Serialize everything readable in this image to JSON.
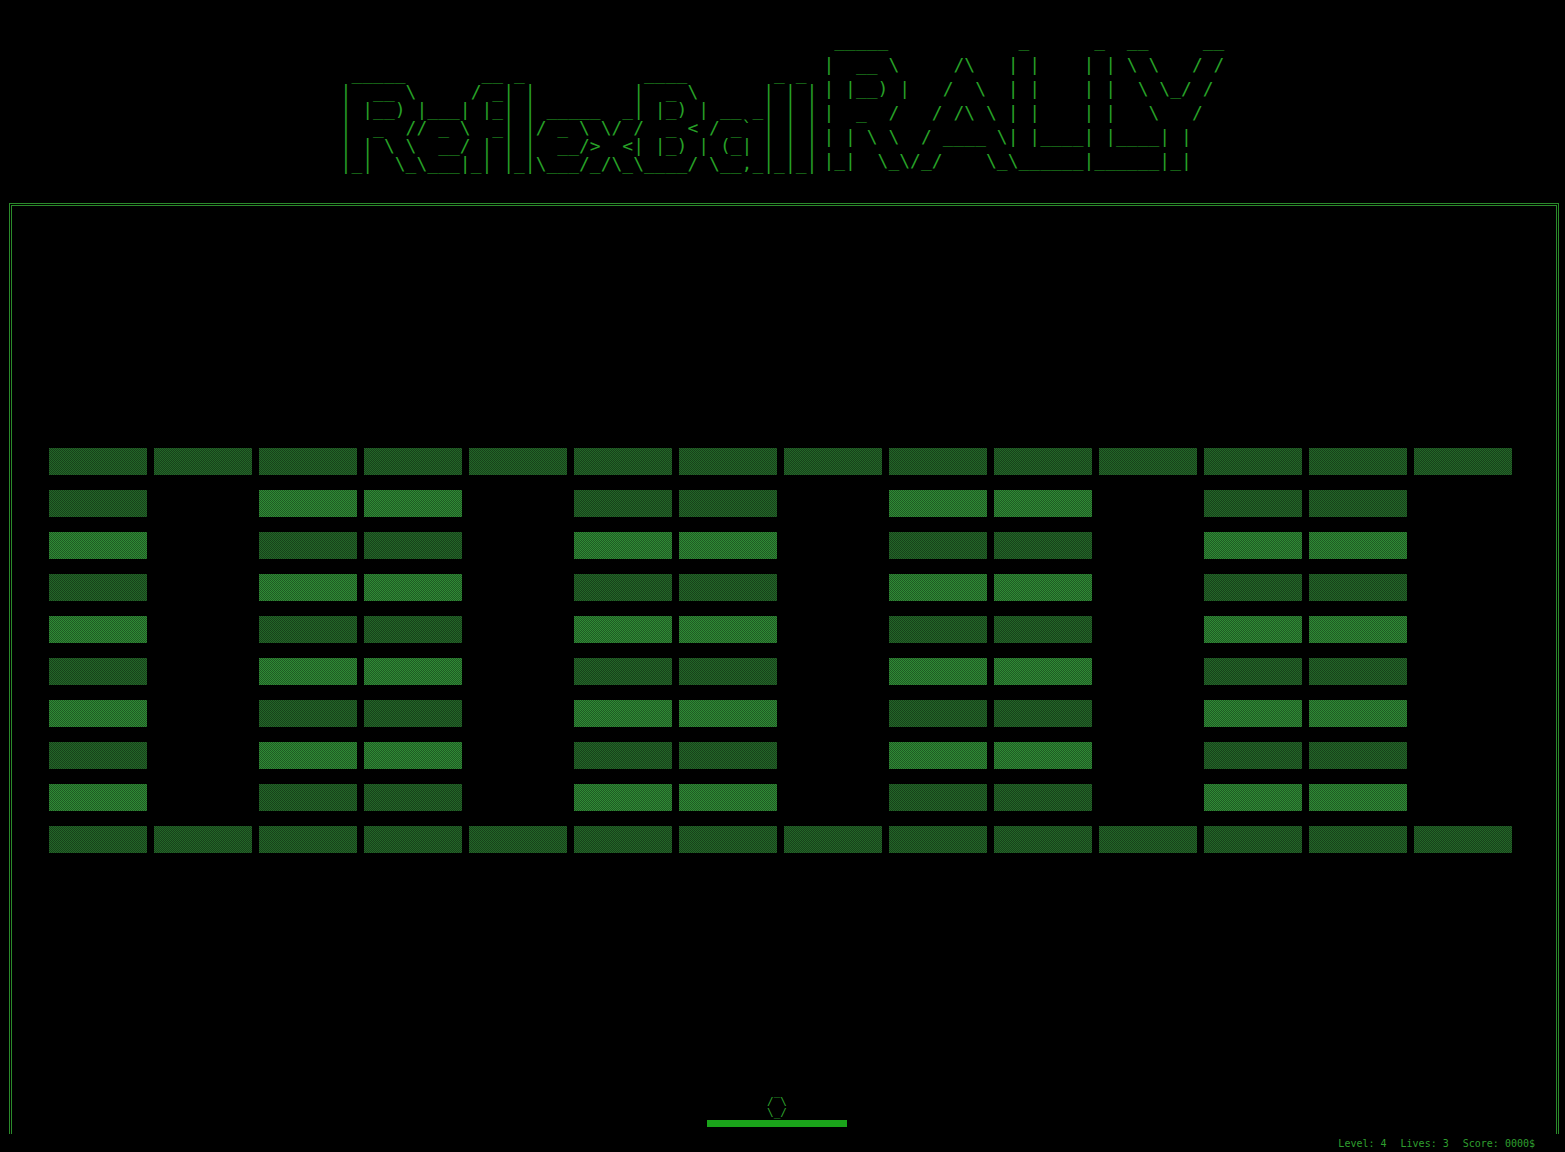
{
  "title": {
    "wordmark": [
      " _____       __ _           ____        _ _ ",
      "|  __ \\     / _| |         |  _ \\      | | |",
      "| |__) |___| |_| | _____  _| |_) | __ _| | |",
      "|  _  // _ \\  _| |/ _ \\ \\/ /  _ < / _` | | |",
      "| | \\ \\  __/ | | |  __/>  <| |_) | (_| | | |",
      "|_|  \\_\\___|_| |_|\\___/_/\\_\\____/ \\__,_|_|_|"
    ],
    "rally": [
      " _____            _      _  __     __",
      "|  __ \\     /\\   | |    | | \\ \\   / /",
      "| |__) |   /  \\  | |    | |  \\ \\_/ / ",
      "|  _  /   / /\\ \\ | |    | |   \\   /  ",
      "| | \\ \\  / ____ \\| |____| |____| |   ",
      "|_|  \\_\\/_/    \\_\\______|______|_|   "
    ]
  },
  "field": {
    "bricks": [
      [
        {
          "present": true,
          "strength": 1
        },
        {
          "present": true,
          "strength": 1
        },
        {
          "present": true,
          "strength": 1
        },
        {
          "present": true,
          "strength": 1
        },
        {
          "present": true,
          "strength": 1
        },
        {
          "present": true,
          "strength": 1
        },
        {
          "present": true,
          "strength": 1
        },
        {
          "present": true,
          "strength": 1
        },
        {
          "present": true,
          "strength": 1
        },
        {
          "present": true,
          "strength": 1
        },
        {
          "present": true,
          "strength": 1
        },
        {
          "present": true,
          "strength": 1
        },
        {
          "present": true,
          "strength": 1
        },
        {
          "present": true,
          "strength": 1
        }
      ],
      [
        {
          "present": true,
          "strength": 1
        },
        {
          "present": false,
          "strength": 0
        },
        {
          "present": true,
          "strength": 2
        },
        {
          "present": true,
          "strength": 2
        },
        {
          "present": false,
          "strength": 0
        },
        {
          "present": true,
          "strength": 1
        },
        {
          "present": true,
          "strength": 1
        },
        {
          "present": false,
          "strength": 0
        },
        {
          "present": true,
          "strength": 2
        },
        {
          "present": true,
          "strength": 2
        },
        {
          "present": false,
          "strength": 0
        },
        {
          "present": true,
          "strength": 1
        },
        {
          "present": true,
          "strength": 1
        },
        {
          "present": false,
          "strength": 0
        }
      ],
      [
        {
          "present": true,
          "strength": 2
        },
        {
          "present": false,
          "strength": 0
        },
        {
          "present": true,
          "strength": 1
        },
        {
          "present": true,
          "strength": 1
        },
        {
          "present": false,
          "strength": 0
        },
        {
          "present": true,
          "strength": 2
        },
        {
          "present": true,
          "strength": 2
        },
        {
          "present": false,
          "strength": 0
        },
        {
          "present": true,
          "strength": 1
        },
        {
          "present": true,
          "strength": 1
        },
        {
          "present": false,
          "strength": 0
        },
        {
          "present": true,
          "strength": 2
        },
        {
          "present": true,
          "strength": 2
        },
        {
          "present": false,
          "strength": 0
        }
      ],
      [
        {
          "present": true,
          "strength": 1
        },
        {
          "present": false,
          "strength": 0
        },
        {
          "present": true,
          "strength": 2
        },
        {
          "present": true,
          "strength": 2
        },
        {
          "present": false,
          "strength": 0
        },
        {
          "present": true,
          "strength": 1
        },
        {
          "present": true,
          "strength": 1
        },
        {
          "present": false,
          "strength": 0
        },
        {
          "present": true,
          "strength": 2
        },
        {
          "present": true,
          "strength": 2
        },
        {
          "present": false,
          "strength": 0
        },
        {
          "present": true,
          "strength": 1
        },
        {
          "present": true,
          "strength": 1
        },
        {
          "present": false,
          "strength": 0
        }
      ],
      [
        {
          "present": true,
          "strength": 2
        },
        {
          "present": false,
          "strength": 0
        },
        {
          "present": true,
          "strength": 1
        },
        {
          "present": true,
          "strength": 1
        },
        {
          "present": false,
          "strength": 0
        },
        {
          "present": true,
          "strength": 2
        },
        {
          "present": true,
          "strength": 2
        },
        {
          "present": false,
          "strength": 0
        },
        {
          "present": true,
          "strength": 1
        },
        {
          "present": true,
          "strength": 1
        },
        {
          "present": false,
          "strength": 0
        },
        {
          "present": true,
          "strength": 2
        },
        {
          "present": true,
          "strength": 2
        },
        {
          "present": false,
          "strength": 0
        }
      ],
      [
        {
          "present": true,
          "strength": 1
        },
        {
          "present": false,
          "strength": 0
        },
        {
          "present": true,
          "strength": 2
        },
        {
          "present": true,
          "strength": 2
        },
        {
          "present": false,
          "strength": 0
        },
        {
          "present": true,
          "strength": 1
        },
        {
          "present": true,
          "strength": 1
        },
        {
          "present": false,
          "strength": 0
        },
        {
          "present": true,
          "strength": 2
        },
        {
          "present": true,
          "strength": 2
        },
        {
          "present": false,
          "strength": 0
        },
        {
          "present": true,
          "strength": 1
        },
        {
          "present": true,
          "strength": 1
        },
        {
          "present": false,
          "strength": 0
        }
      ],
      [
        {
          "present": true,
          "strength": 2
        },
        {
          "present": false,
          "strength": 0
        },
        {
          "present": true,
          "strength": 1
        },
        {
          "present": true,
          "strength": 1
        },
        {
          "present": false,
          "strength": 0
        },
        {
          "present": true,
          "strength": 2
        },
        {
          "present": true,
          "strength": 2
        },
        {
          "present": false,
          "strength": 0
        },
        {
          "present": true,
          "strength": 1
        },
        {
          "present": true,
          "strength": 1
        },
        {
          "present": false,
          "strength": 0
        },
        {
          "present": true,
          "strength": 2
        },
        {
          "present": true,
          "strength": 2
        },
        {
          "present": false,
          "strength": 0
        }
      ],
      [
        {
          "present": true,
          "strength": 1
        },
        {
          "present": false,
          "strength": 0
        },
        {
          "present": true,
          "strength": 2
        },
        {
          "present": true,
          "strength": 2
        },
        {
          "present": false,
          "strength": 0
        },
        {
          "present": true,
          "strength": 1
        },
        {
          "present": true,
          "strength": 1
        },
        {
          "present": false,
          "strength": 0
        },
        {
          "present": true,
          "strength": 2
        },
        {
          "present": true,
          "strength": 2
        },
        {
          "present": false,
          "strength": 0
        },
        {
          "present": true,
          "strength": 1
        },
        {
          "present": true,
          "strength": 1
        },
        {
          "present": false,
          "strength": 0
        }
      ],
      [
        {
          "present": true,
          "strength": 2
        },
        {
          "present": false,
          "strength": 0
        },
        {
          "present": true,
          "strength": 1
        },
        {
          "present": true,
          "strength": 1
        },
        {
          "present": false,
          "strength": 0
        },
        {
          "present": true,
          "strength": 2
        },
        {
          "present": true,
          "strength": 2
        },
        {
          "present": false,
          "strength": 0
        },
        {
          "present": true,
          "strength": 1
        },
        {
          "present": true,
          "strength": 1
        },
        {
          "present": false,
          "strength": 0
        },
        {
          "present": true,
          "strength": 2
        },
        {
          "present": true,
          "strength": 2
        },
        {
          "present": false,
          "strength": 0
        }
      ],
      [
        {
          "present": true,
          "strength": 1
        },
        {
          "present": true,
          "strength": 1
        },
        {
          "present": true,
          "strength": 1
        },
        {
          "present": true,
          "strength": 1
        },
        {
          "present": true,
          "strength": 1
        },
        {
          "present": true,
          "strength": 1
        },
        {
          "present": true,
          "strength": 1
        },
        {
          "present": true,
          "strength": 1
        },
        {
          "present": true,
          "strength": 1
        },
        {
          "present": true,
          "strength": 1
        },
        {
          "present": true,
          "strength": 1
        },
        {
          "present": true,
          "strength": 1
        },
        {
          "present": true,
          "strength": 1
        },
        {
          "present": true,
          "strength": 1
        }
      ]
    ]
  },
  "ball": {
    "art": [
      "/‾\\",
      "\\_/"
    ]
  },
  "status_bar": [
    {
      "label": "Level:",
      "value": "4"
    },
    {
      "label": "Lives:",
      "value": "3"
    },
    {
      "label": "Score:",
      "value": "0000$"
    }
  ]
}
